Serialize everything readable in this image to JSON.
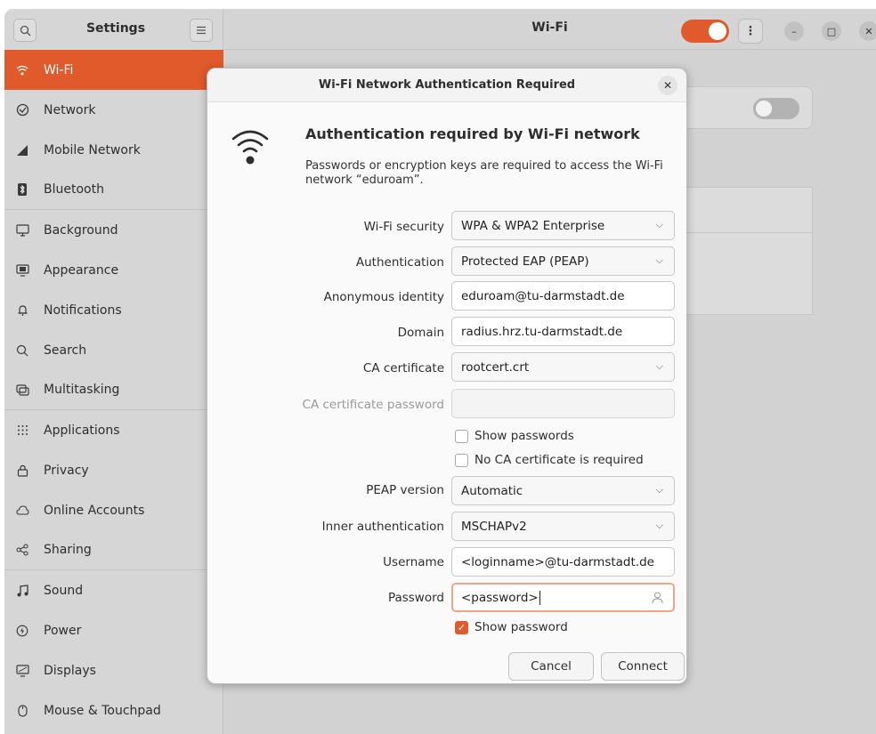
{
  "sidebar": {
    "title": "Settings",
    "items": [
      {
        "label": "Wi-Fi",
        "icon": "wifi-icon"
      },
      {
        "label": "Network",
        "icon": "network-icon"
      },
      {
        "label": "Mobile Network",
        "icon": "mobile-network-icon"
      },
      {
        "label": "Bluetooth",
        "icon": "bluetooth-icon"
      },
      {
        "label": "Background",
        "icon": "background-icon"
      },
      {
        "label": "Appearance",
        "icon": "appearance-icon"
      },
      {
        "label": "Notifications",
        "icon": "bell-icon"
      },
      {
        "label": "Search",
        "icon": "search-icon"
      },
      {
        "label": "Multitasking",
        "icon": "multitasking-icon"
      },
      {
        "label": "Applications",
        "icon": "applications-icon"
      },
      {
        "label": "Privacy",
        "icon": "lock-icon"
      },
      {
        "label": "Online Accounts",
        "icon": "cloud-icon"
      },
      {
        "label": "Sharing",
        "icon": "share-icon"
      },
      {
        "label": "Sound",
        "icon": "music-note-icon"
      },
      {
        "label": "Power",
        "icon": "power-icon"
      },
      {
        "label": "Displays",
        "icon": "display-icon"
      },
      {
        "label": "Mouse & Touchpad",
        "icon": "mouse-icon"
      }
    ]
  },
  "header": {
    "title": "Wi-Fi"
  },
  "accent_color": "#e05a2b",
  "dialog": {
    "title": "Wi-Fi Network Authentication Required",
    "heading": "Authentication required by Wi-Fi network",
    "description": "Passwords or encryption keys are required to access the Wi-Fi network “eduroam”.",
    "fields": {
      "wifi_security": {
        "label": "Wi-Fi security",
        "value": "WPA & WPA2 Enterprise"
      },
      "authentication": {
        "label": "Authentication",
        "value": "Protected EAP (PEAP)"
      },
      "anonymous_identity": {
        "label": "Anonymous identity",
        "value": "eduroam@tu-darmstadt.de"
      },
      "domain": {
        "label": "Domain",
        "value": "radius.hrz.tu-darmstadt.de"
      },
      "ca_certificate": {
        "label": "CA certificate",
        "value": "rootcert.crt"
      },
      "ca_certificate_password": {
        "label": "CA certificate password",
        "value": ""
      },
      "peap_version": {
        "label": "PEAP version",
        "value": "Automatic"
      },
      "inner_authentication": {
        "label": "Inner authentication",
        "value": "MSCHAPv2"
      },
      "username": {
        "label": "Username",
        "value": "<loginname>@tu-darmstadt.de"
      },
      "password": {
        "label": "Password",
        "value": "<password>"
      }
    },
    "checkboxes": {
      "show_passwords": {
        "label": "Show passwords",
        "checked": false
      },
      "no_ca_required": {
        "label": "No CA certificate is required",
        "checked": false
      },
      "show_password": {
        "label": "Show password",
        "checked": true
      }
    },
    "buttons": {
      "cancel": "Cancel",
      "connect": "Connect"
    }
  }
}
